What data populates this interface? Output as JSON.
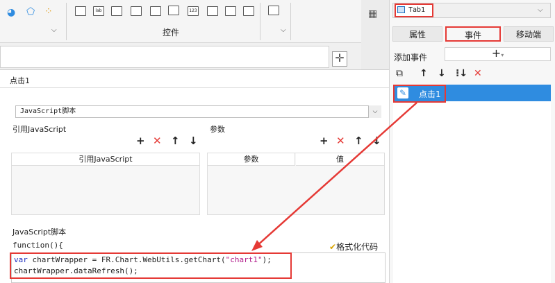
{
  "toolbar": {
    "group_label": "控件"
  },
  "right_panel": {
    "tab_select": "Tab1",
    "tabs": [
      "属性",
      "事件",
      "移动端"
    ],
    "add_event_label": "添加事件",
    "add_event_button": "+",
    "event_item": "点击1"
  },
  "main": {
    "title": "点击1",
    "type_select": "JavaScript脚本",
    "ref_section": "引用JavaScript",
    "ref_column": "引用JavaScript",
    "param_section": "参数",
    "param_columns": [
      "参数",
      "值"
    ],
    "script_title": "JavaScript脚本",
    "func_label": "function(){",
    "format_button": "格式化代码",
    "code": {
      "line1_kw": "var",
      "line1_mid": " chartWrapper = FR.Chart.WebUtils.getChart(",
      "line1_str": "\"chart1\"",
      "line1_end": ");",
      "line2": "chartWrapper.dataRefresh();"
    }
  },
  "colors": {
    "highlight": "#e53935",
    "selected": "#2f8ce0"
  }
}
